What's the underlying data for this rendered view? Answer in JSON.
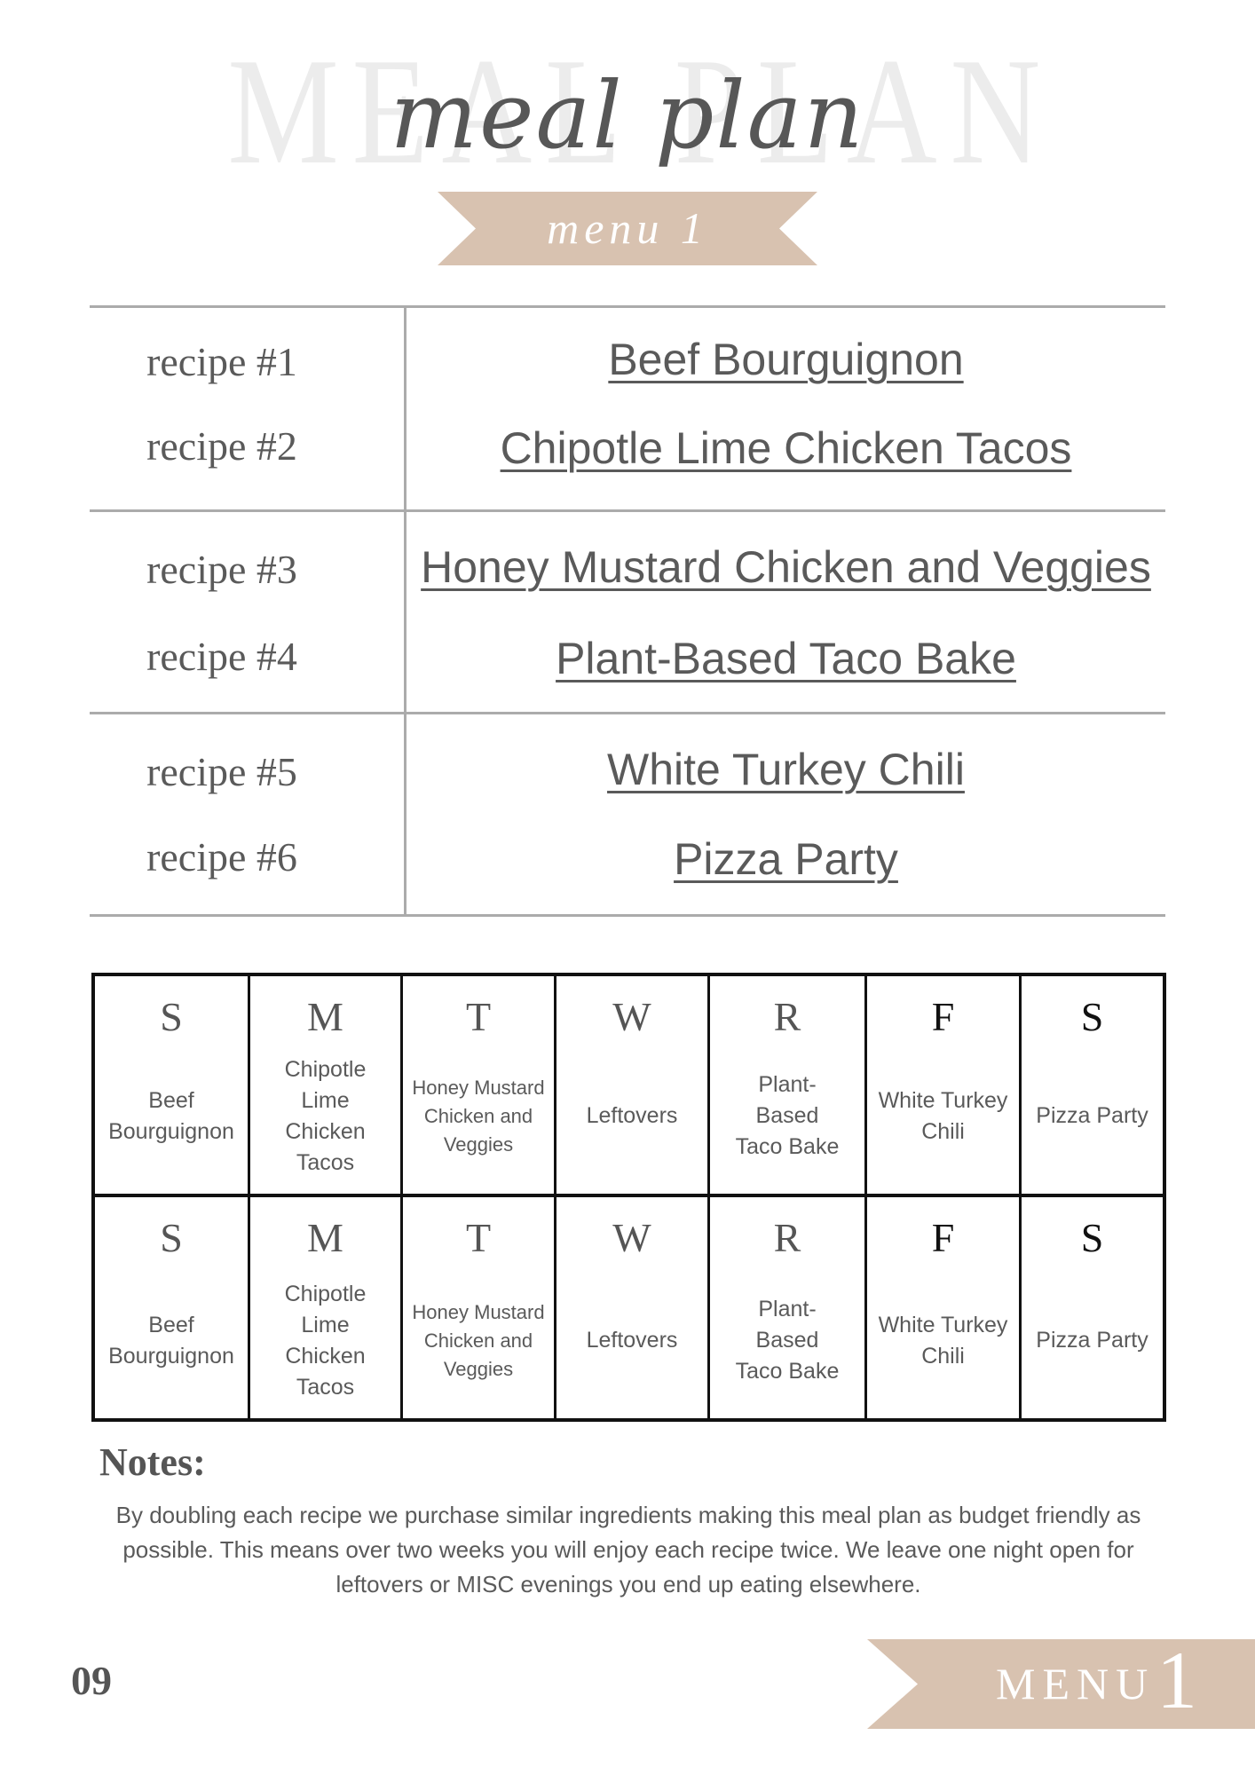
{
  "header": {
    "background_title": "MEAL PLAN",
    "script_title": "meal plan",
    "banner_label": "menu 1"
  },
  "colors": {
    "accent": "#d8c2b0",
    "text": "#5a5a5a",
    "watermark": "#ececec",
    "grid_border": "#111111"
  },
  "recipes": [
    {
      "label": "recipe #1",
      "name": "Beef Bourguignon"
    },
    {
      "label": "recipe #2",
      "name": "Chipotle Lime Chicken Tacos"
    },
    {
      "label": "recipe #3",
      "name": "Honey Mustard Chicken and Veggies"
    },
    {
      "label": "recipe #4",
      "name": "Plant-Based Taco Bake"
    },
    {
      "label": "recipe #5",
      "name": "White Turkey Chili"
    },
    {
      "label": "recipe #6",
      "name": "Pizza Party"
    }
  ],
  "weeks": [
    {
      "days": [
        {
          "day": "S",
          "meal": "Beef Bourguignon"
        },
        {
          "day": "M",
          "meal": "Chipotle Lime Chicken Tacos"
        },
        {
          "day": "T",
          "meal": "Honey Mustard Chicken and Veggies"
        },
        {
          "day": "W",
          "meal": "Leftovers"
        },
        {
          "day": "R",
          "meal": "Plant-Based Taco Bake"
        },
        {
          "day": "F",
          "meal": "White Turkey Chili"
        },
        {
          "day": "S",
          "meal": "Pizza Party"
        }
      ]
    },
    {
      "days": [
        {
          "day": "S",
          "meal": "Beef Bourguignon"
        },
        {
          "day": "M",
          "meal": "Chipotle Lime Chicken Tacos"
        },
        {
          "day": "T",
          "meal": "Honey Mustard Chicken and Veggies"
        },
        {
          "day": "W",
          "meal": "Leftovers"
        },
        {
          "day": "R",
          "meal": "Plant-Based Taco Bake"
        },
        {
          "day": "F",
          "meal": "White Turkey Chili"
        },
        {
          "day": "S",
          "meal": "Pizza Party"
        }
      ]
    }
  ],
  "notes": {
    "title": "Notes:",
    "body": "By doubling each recipe we purchase similar ingredients making this meal plan as budget friendly as possible. This means over two weeks you will enjoy each recipe twice. We leave one night open for leftovers or MISC evenings you end up eating elsewhere."
  },
  "footer": {
    "page_number": "09",
    "menu_label": "MENU",
    "menu_number": "1"
  }
}
